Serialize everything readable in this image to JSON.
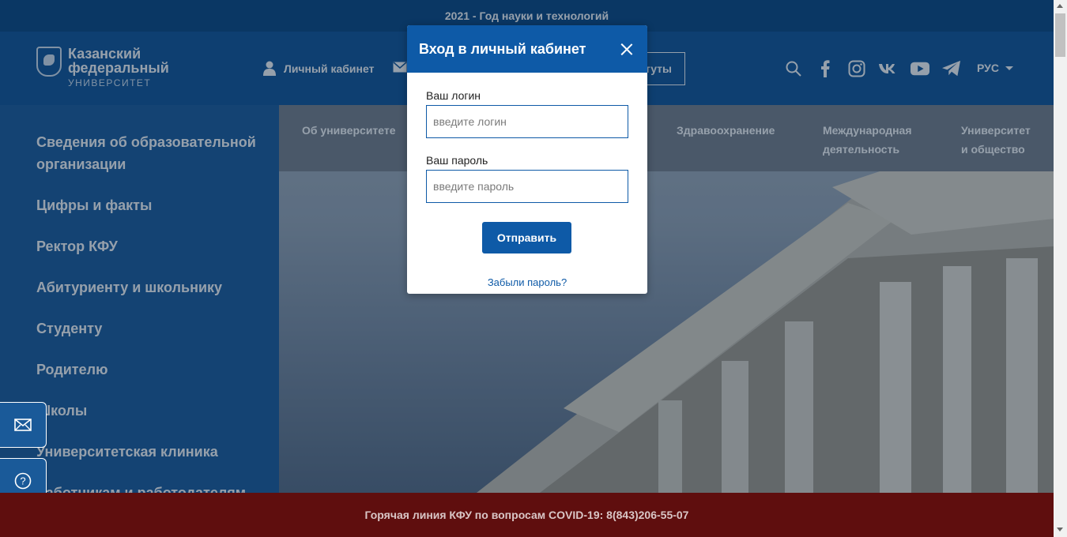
{
  "topbar": {
    "text": "2021 - Год науки и технологий"
  },
  "header": {
    "logo": {
      "line1": "Казанский",
      "line2": "федеральный",
      "line3": "УНИВЕРСИТЕТ"
    },
    "cabinet_label": "Личный кабинет",
    "institutes_label": "итуты",
    "language": "РУС"
  },
  "sidebar": {
    "items": [
      {
        "label": "Сведения об образовательной организации"
      },
      {
        "label": "Цифры и факты"
      },
      {
        "label": "Ректор КФУ"
      },
      {
        "label": "Абитуриенту и школьнику"
      },
      {
        "label": "Студенту"
      },
      {
        "label": "Родителю"
      },
      {
        "label": "Школы"
      },
      {
        "label": "Университетская клиника"
      },
      {
        "label": "Работникам и работодателям"
      }
    ]
  },
  "nav": {
    "items": [
      {
        "label": "Об университете"
      },
      {
        "label": "Здравоохранение"
      },
      {
        "label": "Международная деятельность"
      },
      {
        "label": "Университет и общество"
      }
    ]
  },
  "modal": {
    "title": "Вход в личный кабинет",
    "login_label": "Ваш логин",
    "login_placeholder": "введите логин",
    "login_value": "",
    "password_label": "Ваш пароль",
    "password_placeholder": "введите пароль",
    "password_value": "",
    "submit_label": "Отправить",
    "forgot_label": "Забыли пароль?"
  },
  "footer": {
    "text": "Горячая линия КФУ по вопросам COVID-19: 8(843)206-55-07"
  },
  "icons": [
    "search-icon",
    "facebook-icon",
    "instagram-icon",
    "vk-icon",
    "youtube-icon",
    "telegram-icon",
    "mail-icon",
    "help-icon",
    "user-icon",
    "close-icon"
  ],
  "colors": {
    "primary": "#0e5aa7",
    "header": "#15599b",
    "sidebar": "#1f5f9f",
    "footer": "#7a1212"
  }
}
